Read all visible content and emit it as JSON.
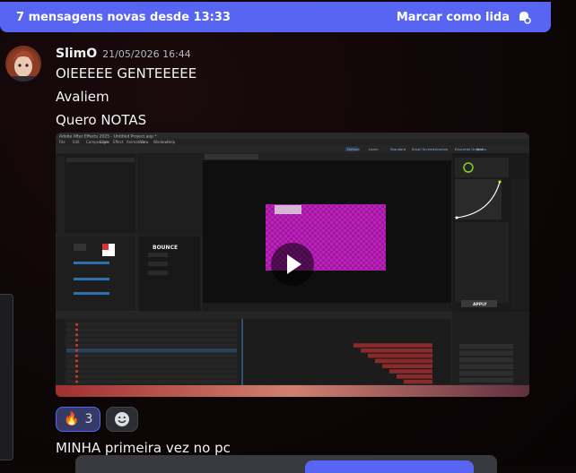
{
  "banner": {
    "new_messages_text": "7 mensagens novas desde 13:33",
    "mark_read_label": "Marcar como lida"
  },
  "message": {
    "author": "SlimO",
    "timestamp": "21/05/2026 16:44",
    "lines": [
      "OIEEEEE GENTEEEEE",
      "Avaliem",
      "Quero NOTAS"
    ],
    "attachment": {
      "window_title": "Adobe After Effects 2025 - Untitled Project.aep *",
      "menu_items": [
        "File",
        "Edit",
        "Composition",
        "Layer",
        "Effect",
        "Animation",
        "View",
        "Window",
        "Help"
      ],
      "workspace_tabs": [
        "Default",
        "Learn",
        "Standard",
        "Small Screen",
        "Libraries",
        "Essential Graphics",
        "Text"
      ],
      "effect_name": "BOUNCE",
      "apply_label": "APPLY"
    },
    "next_line": "MINHA primeira vez no pc"
  },
  "reactions": [
    {
      "emoji": "🔥",
      "count": "3"
    },
    {
      "emoji": "☺",
      "count": ""
    }
  ],
  "colors": {
    "brand": "#5865f2",
    "comp_magenta": "#c020c0",
    "timeline_red": "#c0392b"
  }
}
